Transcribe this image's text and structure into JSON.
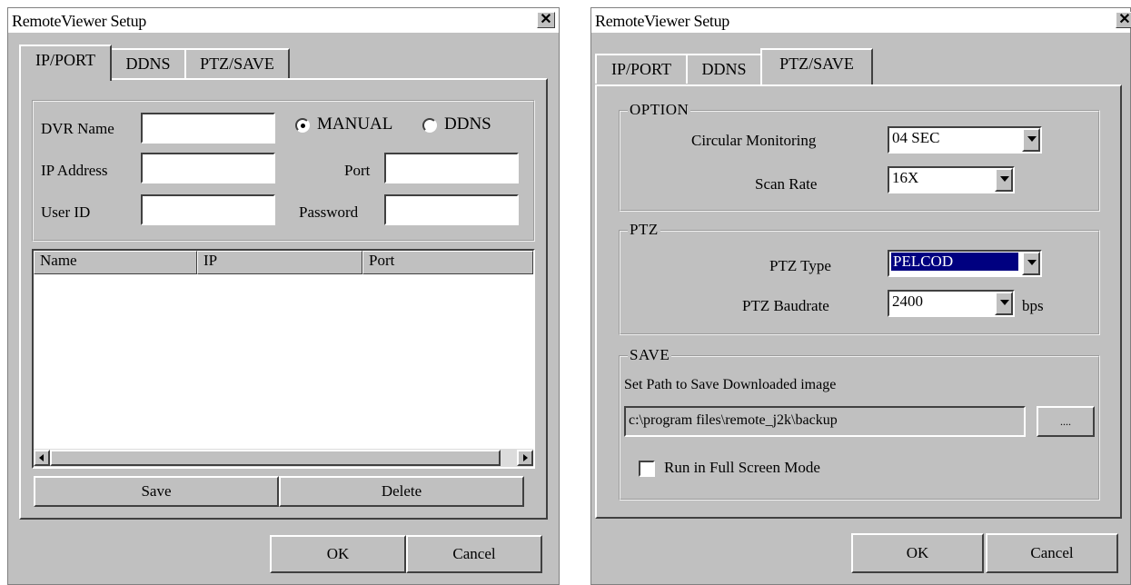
{
  "dialog1": {
    "title": "RemoteViewer Setup",
    "tabs": [
      "IP/PORT",
      "DDNS",
      "PTZ/SAVE"
    ],
    "dvr_name_label": "DVR Name",
    "dvr_name_value": "",
    "radio_manual_label": "MANUAL",
    "radio_ddns_label": "DDNS",
    "radio_selected": "MANUAL",
    "ip_label": "IP Address",
    "ip_value": "",
    "port_label": "Port",
    "port_value": "",
    "userid_label": "User ID",
    "userid_value": "",
    "password_label": "Password",
    "password_value": "",
    "list_columns": [
      "Name",
      "IP",
      "Port"
    ],
    "list_rows": [],
    "save_label": "Save",
    "delete_label": "Delete",
    "ok_label": "OK",
    "cancel_label": "Cancel"
  },
  "dialog2": {
    "title": "RemoteViewer Setup",
    "tabs": [
      "IP/PORT",
      "DDNS",
      "PTZ/SAVE"
    ],
    "option_legend": "OPTION",
    "circular_label": "Circular Monitoring",
    "circular_value": "04 SEC",
    "scanrate_label": "Scan Rate",
    "scanrate_value": "16X",
    "ptz_legend": "PTZ",
    "ptz_type_label": "PTZ Type",
    "ptz_type_value": "PELCOD",
    "ptz_baud_label": "PTZ Baudrate",
    "ptz_baud_value": "2400",
    "bps_label": "bps",
    "save_legend": "SAVE",
    "save_path_caption": "Set Path to Save Downloaded image",
    "save_path_value": "c:\\program files\\remote_j2k\\backup",
    "browse_label": "....",
    "fullscreen_label": "Run in Full Screen Mode",
    "fullscreen_checked": false,
    "ok_label": "OK",
    "cancel_label": "Cancel"
  },
  "colors": {
    "dialog_face": "#c0c0c0",
    "highlight": "#000080",
    "titlebar_bg": "#ffffff"
  },
  "icons": {
    "close": "close-icon",
    "dropdown": "chevron-down-icon",
    "scroll_left": "arrow-left-icon",
    "scroll_right": "arrow-right-icon"
  }
}
